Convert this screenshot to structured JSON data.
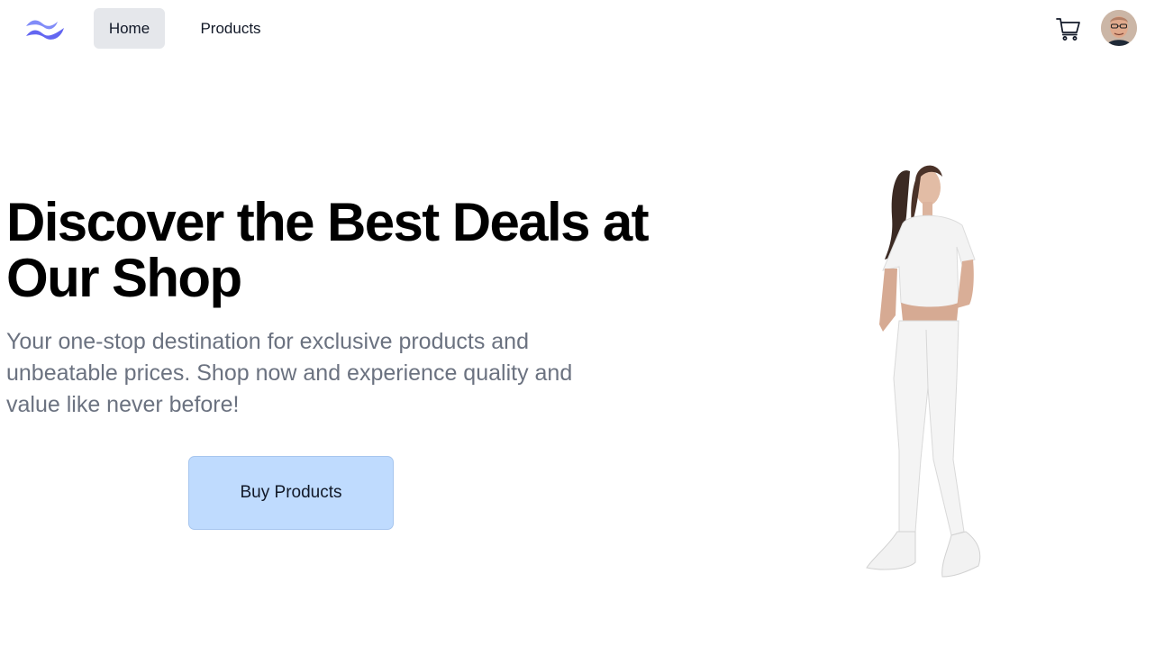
{
  "nav": {
    "logo_icon": "tailwind-waves-logo",
    "links": [
      {
        "label": "Home",
        "active": true
      },
      {
        "label": "Products",
        "active": false
      }
    ],
    "cart_icon": "shopping-cart-icon",
    "avatar_icon": "user-avatar"
  },
  "hero": {
    "title": "Discover the Best Deals at Our Shop",
    "subtitle": "Your one-stop destination for exclusive products and unbeatable prices. Shop now and experience quality and value like never before!",
    "cta_label": "Buy Products",
    "image_icon": "woman-in-white-outfit-image"
  },
  "colors": {
    "accent_logo": "#6366f1",
    "active_nav_bg": "#e5e7eb",
    "cta_bg": "#bfdbfe",
    "subtitle_text": "#6b7280"
  }
}
